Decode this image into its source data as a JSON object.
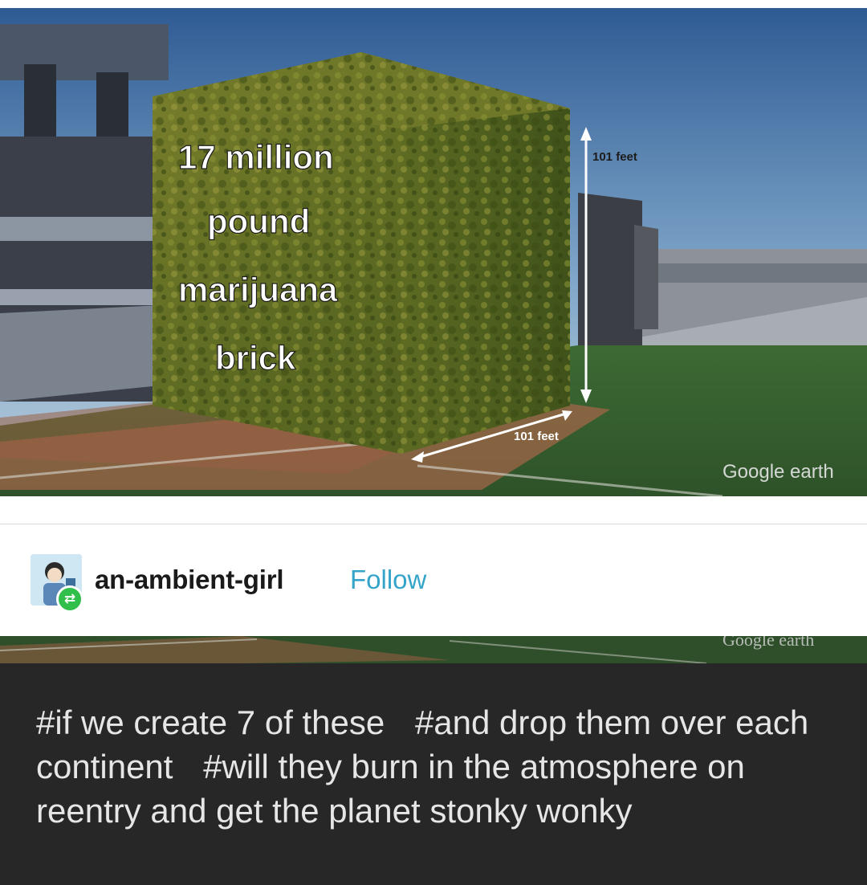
{
  "image": {
    "overlay_text": [
      "17 million",
      "pound",
      "marijuana",
      "brick"
    ],
    "height_label": "101 feet",
    "width_label": "101 feet",
    "watermark": "Google earth",
    "strip_watermark": "Google earth"
  },
  "post": {
    "username": "an-ambient-girl",
    "follow_label": "Follow",
    "reblog_icon": "reblog-icon"
  },
  "tags": [
    "#if we create 7 of these",
    "#and drop them over each continent",
    "#will they burn in the atmosphere on reentry and get the planet stonky wonky"
  ],
  "colors": {
    "follow": "#35a4c9",
    "reblog_badge": "#2fbf4a",
    "tags_background": "#272727"
  }
}
